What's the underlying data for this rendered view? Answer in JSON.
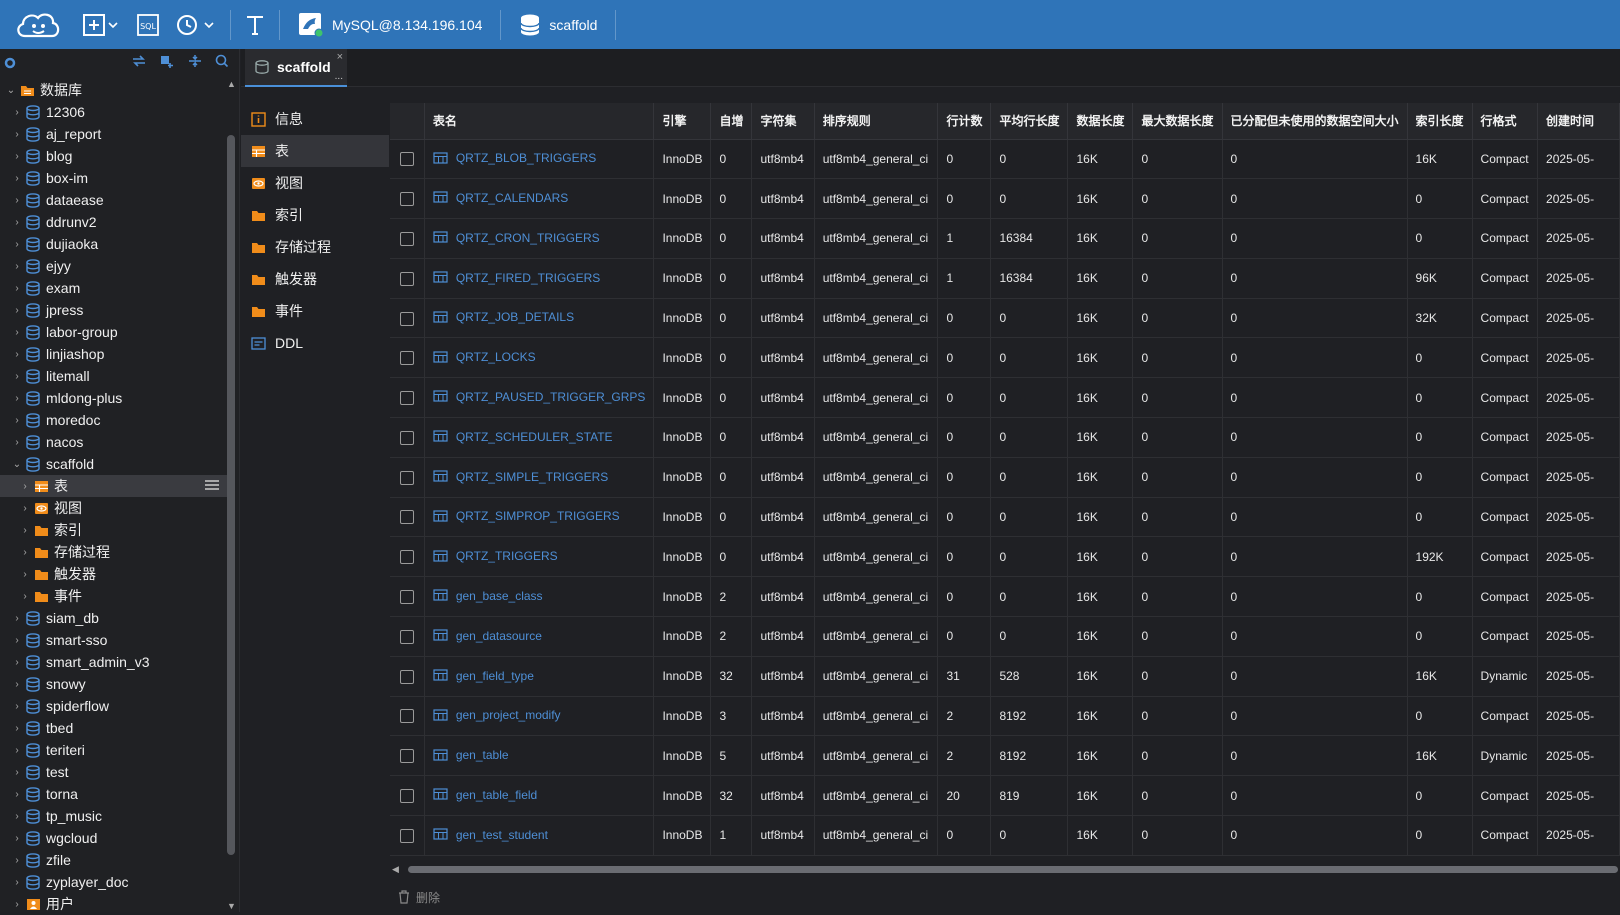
{
  "toolbar": {
    "connection_label": "MySQL@8.134.196.104",
    "database_label": "scaffold"
  },
  "sidebar": {
    "root_label": "数据库",
    "databases": [
      "12306",
      "aj_report",
      "blog",
      "box-im",
      "dataease",
      "ddrunv2",
      "dujiaoka",
      "ejyy",
      "exam",
      "jpress",
      "labor-group",
      "linjiashop",
      "litemall",
      "mldong-plus",
      "moredoc",
      "nacos",
      "scaffold"
    ],
    "scaffold_children": [
      "表",
      "视图",
      "索引",
      "存储过程",
      "触发器",
      "事件"
    ],
    "databases_after": [
      "siam_db",
      "smart-sso",
      "smart_admin_v3",
      "snowy",
      "spiderflow",
      "tbed",
      "teriteri",
      "test",
      "torna",
      "tp_music",
      "wgcloud",
      "zfile",
      "zyplayer_doc"
    ],
    "users_label": "用户"
  },
  "tab": {
    "label": "scaffold",
    "close": "×",
    "more": "..."
  },
  "objtypes": [
    "信息",
    "表",
    "视图",
    "索引",
    "存储过程",
    "触发器",
    "事件",
    "DDL"
  ],
  "grid": {
    "columns": [
      "表名",
      "引擎",
      "自增",
      "字符集",
      "排序规则",
      "行计数",
      "平均行长度",
      "数据长度",
      "最大数据长度",
      "已分配但未使用的数据空间大小",
      "索引长度",
      "行格式",
      "创建时间"
    ],
    "rows": [
      [
        "QRTZ_BLOB_TRIGGERS",
        "InnoDB",
        "0",
        "utf8mb4",
        "utf8mb4_general_ci",
        "0",
        "0",
        "16K",
        "0",
        "0",
        "16K",
        "Compact",
        "2025-05-"
      ],
      [
        "QRTZ_CALENDARS",
        "InnoDB",
        "0",
        "utf8mb4",
        "utf8mb4_general_ci",
        "0",
        "0",
        "16K",
        "0",
        "0",
        "0",
        "Compact",
        "2025-05-"
      ],
      [
        "QRTZ_CRON_TRIGGERS",
        "InnoDB",
        "0",
        "utf8mb4",
        "utf8mb4_general_ci",
        "1",
        "16384",
        "16K",
        "0",
        "0",
        "0",
        "Compact",
        "2025-05-"
      ],
      [
        "QRTZ_FIRED_TRIGGERS",
        "InnoDB",
        "0",
        "utf8mb4",
        "utf8mb4_general_ci",
        "1",
        "16384",
        "16K",
        "0",
        "0",
        "96K",
        "Compact",
        "2025-05-"
      ],
      [
        "QRTZ_JOB_DETAILS",
        "InnoDB",
        "0",
        "utf8mb4",
        "utf8mb4_general_ci",
        "0",
        "0",
        "16K",
        "0",
        "0",
        "32K",
        "Compact",
        "2025-05-"
      ],
      [
        "QRTZ_LOCKS",
        "InnoDB",
        "0",
        "utf8mb4",
        "utf8mb4_general_ci",
        "0",
        "0",
        "16K",
        "0",
        "0",
        "0",
        "Compact",
        "2025-05-"
      ],
      [
        "QRTZ_PAUSED_TRIGGER_GRPS",
        "InnoDB",
        "0",
        "utf8mb4",
        "utf8mb4_general_ci",
        "0",
        "0",
        "16K",
        "0",
        "0",
        "0",
        "Compact",
        "2025-05-"
      ],
      [
        "QRTZ_SCHEDULER_STATE",
        "InnoDB",
        "0",
        "utf8mb4",
        "utf8mb4_general_ci",
        "0",
        "0",
        "16K",
        "0",
        "0",
        "0",
        "Compact",
        "2025-05-"
      ],
      [
        "QRTZ_SIMPLE_TRIGGERS",
        "InnoDB",
        "0",
        "utf8mb4",
        "utf8mb4_general_ci",
        "0",
        "0",
        "16K",
        "0",
        "0",
        "0",
        "Compact",
        "2025-05-"
      ],
      [
        "QRTZ_SIMPROP_TRIGGERS",
        "InnoDB",
        "0",
        "utf8mb4",
        "utf8mb4_general_ci",
        "0",
        "0",
        "16K",
        "0",
        "0",
        "0",
        "Compact",
        "2025-05-"
      ],
      [
        "QRTZ_TRIGGERS",
        "InnoDB",
        "0",
        "utf8mb4",
        "utf8mb4_general_ci",
        "0",
        "0",
        "16K",
        "0",
        "0",
        "192K",
        "Compact",
        "2025-05-"
      ],
      [
        "gen_base_class",
        "InnoDB",
        "2",
        "utf8mb4",
        "utf8mb4_general_ci",
        "0",
        "0",
        "16K",
        "0",
        "0",
        "0",
        "Compact",
        "2025-05-"
      ],
      [
        "gen_datasource",
        "InnoDB",
        "2",
        "utf8mb4",
        "utf8mb4_general_ci",
        "0",
        "0",
        "16K",
        "0",
        "0",
        "0",
        "Compact",
        "2025-05-"
      ],
      [
        "gen_field_type",
        "InnoDB",
        "32",
        "utf8mb4",
        "utf8mb4_general_ci",
        "31",
        "528",
        "16K",
        "0",
        "0",
        "16K",
        "Dynamic",
        "2025-05-"
      ],
      [
        "gen_project_modify",
        "InnoDB",
        "3",
        "utf8mb4",
        "utf8mb4_general_ci",
        "2",
        "8192",
        "16K",
        "0",
        "0",
        "0",
        "Compact",
        "2025-05-"
      ],
      [
        "gen_table",
        "InnoDB",
        "5",
        "utf8mb4",
        "utf8mb4_general_ci",
        "2",
        "8192",
        "16K",
        "0",
        "0",
        "16K",
        "Dynamic",
        "2025-05-"
      ],
      [
        "gen_table_field",
        "InnoDB",
        "32",
        "utf8mb4",
        "utf8mb4_general_ci",
        "20",
        "819",
        "16K",
        "0",
        "0",
        "0",
        "Compact",
        "2025-05-"
      ],
      [
        "gen_test_student",
        "InnoDB",
        "1",
        "utf8mb4",
        "utf8mb4_general_ci",
        "0",
        "0",
        "16K",
        "0",
        "0",
        "0",
        "Compact",
        "2025-05-"
      ]
    ]
  },
  "bottom": {
    "delete_label": "删除"
  }
}
